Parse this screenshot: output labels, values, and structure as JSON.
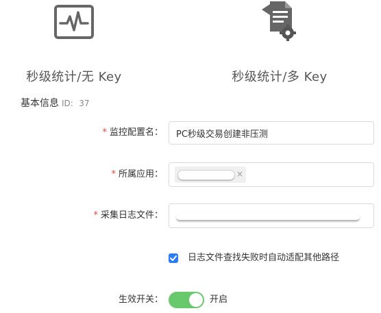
{
  "mode_tiles": [
    {
      "title": "秒级统计/无 Key",
      "icon": "pulse-monitor-icon"
    },
    {
      "title": "秒级统计/多 Key",
      "icon": "document-settings-icon"
    }
  ],
  "section": {
    "title": "基本信息",
    "id_label": "ID:",
    "id_value": "37"
  },
  "form": {
    "required_mark": "*",
    "monitor_name": {
      "label": "监控配置名：",
      "value": "PC秒级交易创建非压测"
    },
    "app": {
      "label": "所属应用：",
      "tag_close": "×"
    },
    "log_file": {
      "label": "采集日志文件："
    },
    "fallback_path": {
      "label": "日志文件查找失败时自动适配其他路径",
      "checked": true
    },
    "enable_switch": {
      "label": "生效开关：",
      "state_text": "开启",
      "on": true
    }
  },
  "colors": {
    "accent": "#2d7cf6",
    "toggle_on": "#67c96b",
    "required": "#e8453c"
  }
}
